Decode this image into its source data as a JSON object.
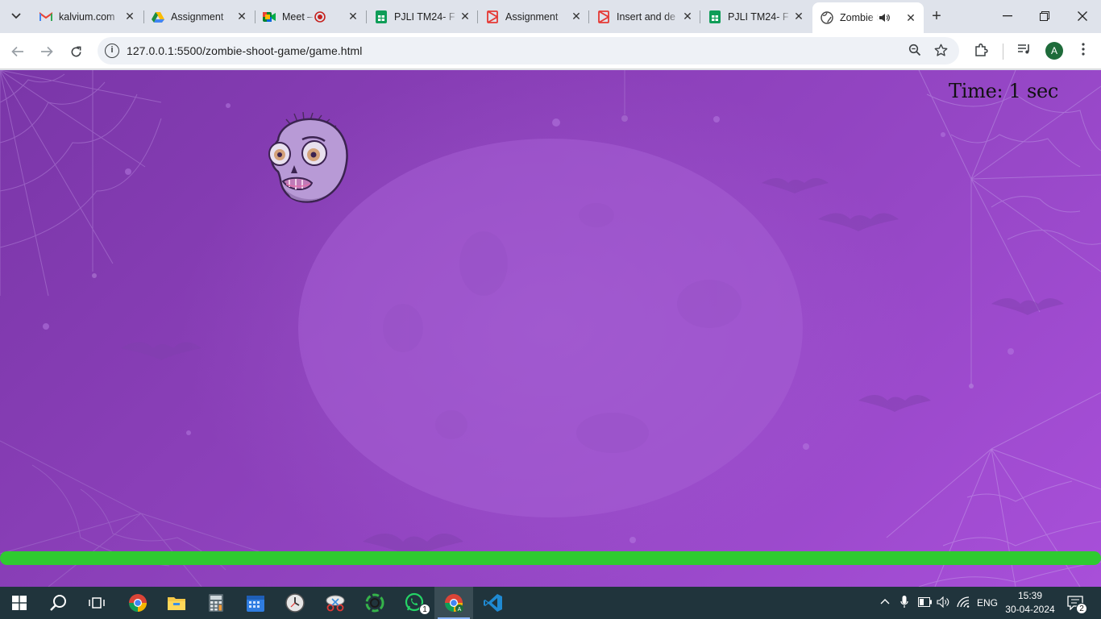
{
  "browser": {
    "tabs": [
      {
        "title": "kalvium.com",
        "favicon": "gmail-icon"
      },
      {
        "title": "Assignment",
        "favicon": "drive-icon"
      },
      {
        "title": "Meet – n",
        "favicon": "meet-icon"
      },
      {
        "title": "PJLI TM24- F",
        "favicon": "sheets-icon"
      },
      {
        "title": "Assignment",
        "favicon": "kalvium-icon"
      },
      {
        "title": "Insert and de",
        "favicon": "kalvium-icon"
      },
      {
        "title": "PJLI TM24- F",
        "favicon": "sheets-icon"
      },
      {
        "title": "Zombie S",
        "favicon": "globe-icon",
        "active": true,
        "audio": true
      }
    ],
    "url": "127.0.0.1:5500/zombie-shoot-game/game.html",
    "profile_initial": "A"
  },
  "game": {
    "timer_label": "Time:",
    "timer_value": "1",
    "timer_unit": "sec",
    "health_fraction": 1.0,
    "colors": {
      "health_bar": "#2fca30",
      "background": "#8a3fb8"
    }
  },
  "taskbar": {
    "apps": [
      "start-icon",
      "search-icon",
      "task-view-icon",
      "chrome-icon",
      "file-explorer-icon",
      "calculator-icon",
      "calendar-icon",
      "clock-icon",
      "snipping-tool-icon",
      "refresh-app-icon",
      "whatsapp-icon",
      "chrome-active-icon",
      "vscode-icon"
    ],
    "whatsapp_badge": "1",
    "language": "ENG",
    "time": "15:39",
    "date": "30-04-2024",
    "notifications_count": "2"
  }
}
